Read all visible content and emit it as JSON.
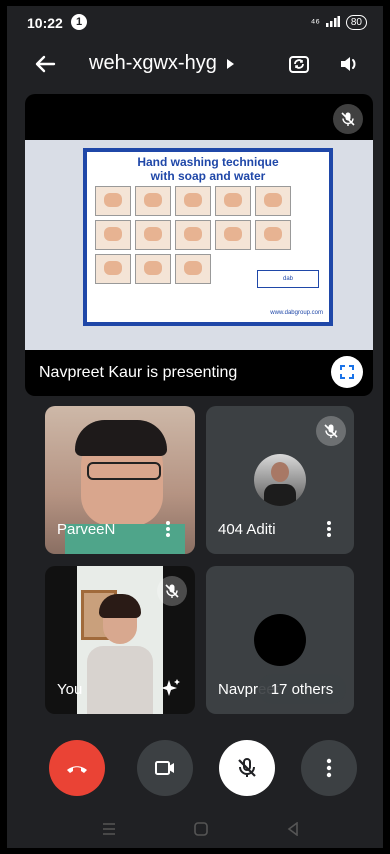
{
  "status": {
    "time": "10:22",
    "notification_count": "1",
    "network": "⁴⁶",
    "battery": "80"
  },
  "header": {
    "meeting_code": "weh-xgwx-hyg",
    "icons": [
      "back-arrow-icon",
      "caret-right-icon",
      "switch-camera-icon",
      "speaker-icon"
    ]
  },
  "presentation": {
    "slide_title_line1": "Hand washing technique",
    "slide_title_line2": "with soap and water",
    "slide_footer": "www.dabgroup.com",
    "presenting_label": "Navpreet Kaur is presenting"
  },
  "participants": [
    {
      "name": "ParveeN",
      "muted": false
    },
    {
      "name": "404 Aditi",
      "muted": true
    },
    {
      "name": "You",
      "muted": true
    },
    {
      "name": "Navpreet",
      "muted": false
    }
  ],
  "others": {
    "label": "17 others"
  },
  "colors": {
    "end_call": "#ea4335",
    "surface": "#3c4043",
    "background": "#202124",
    "poster_blue": "#1f47a8"
  }
}
